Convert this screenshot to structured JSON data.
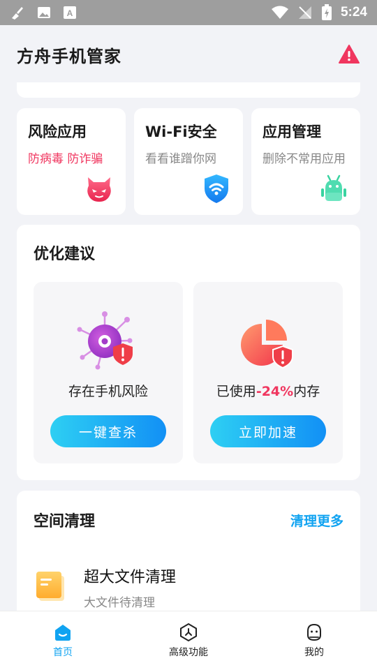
{
  "status_bar": {
    "time": "5:24"
  },
  "header": {
    "title": "方舟手机管家",
    "alert_color": "#f0365f"
  },
  "quick_cards": [
    {
      "title": "风险应用",
      "subtitle": "防病毒 防诈骗",
      "icon": "devil-icon"
    },
    {
      "title": "Wi-Fi安全",
      "subtitle": "看看谁蹭你网",
      "icon": "wifi-shield-icon"
    },
    {
      "title": "应用管理",
      "subtitle": "删除不常用应用",
      "icon": "android-icon"
    }
  ],
  "optimize": {
    "title": "优化建议",
    "risk": {
      "label": "存在手机风险",
      "button": "一键查杀",
      "icon": "virus-shield-icon"
    },
    "memory": {
      "label_prefix": "已使用",
      "percent": "-24%",
      "label_suffix": "内存",
      "button": "立即加速",
      "icon": "pie-chart-shield-icon"
    }
  },
  "cleanup": {
    "title": "空间清理",
    "more": "清理更多",
    "item": {
      "title": "超大文件清理",
      "subtitle": "大文件待清理",
      "icon": "file-icon"
    }
  },
  "tabs": [
    {
      "label": "首页",
      "icon": "home-icon",
      "active": true
    },
    {
      "label": "高级功能",
      "icon": "advanced-icon",
      "active": false
    },
    {
      "label": "我的",
      "icon": "profile-icon",
      "active": false
    }
  ],
  "colors": {
    "accent": "#10a3f1",
    "danger": "#f0365f"
  }
}
